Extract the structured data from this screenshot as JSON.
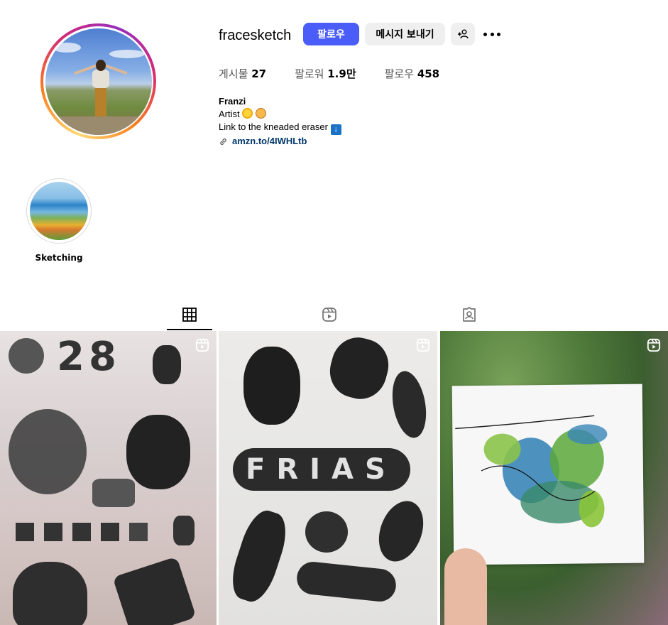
{
  "profile": {
    "username": "fracesketch",
    "follow_label": "팔로우",
    "message_label": "메시지 보내기",
    "suggest_icon": "add-user-icon",
    "more_icon": "more-icon"
  },
  "stats": {
    "posts_label": "게시물",
    "posts_value": "27",
    "followers_label": "팔로워",
    "followers_value": "1.9만",
    "following_label": "팔로우",
    "following_value": "458"
  },
  "bio": {
    "name": "Franzi",
    "line1": "Artist",
    "line2": "Link to the kneaded eraser",
    "link": "amzn.to/4IWHLtb"
  },
  "highlights": [
    {
      "label": "Sketching"
    }
  ],
  "tabs": [
    {
      "name": "posts",
      "icon": "grid-icon",
      "active": true
    },
    {
      "name": "reels",
      "icon": "reels-icon",
      "active": false
    },
    {
      "name": "tagged",
      "icon": "tagged-icon",
      "active": false
    }
  ],
  "colors": {
    "accent": "#4a5df9",
    "link": "#00376b",
    "secondary_bg": "#efefef"
  },
  "posts": [
    {
      "type": "reel",
      "stamp_text": "28"
    },
    {
      "type": "reel",
      "stamp_text": "FRIAS"
    },
    {
      "type": "reel"
    }
  ]
}
